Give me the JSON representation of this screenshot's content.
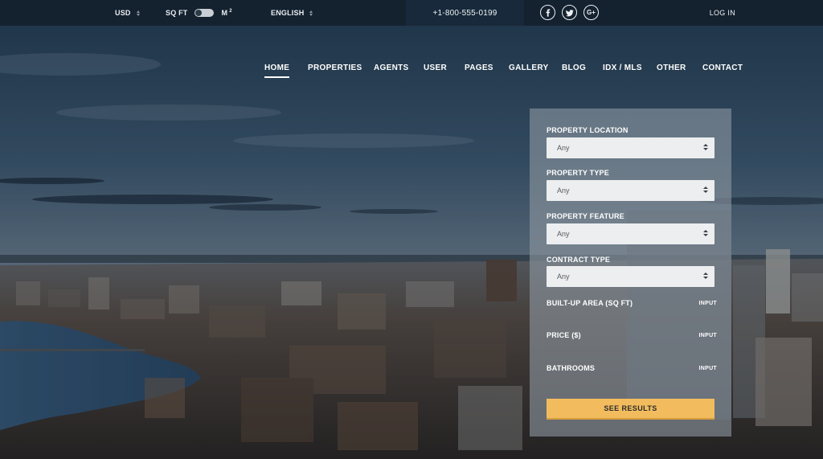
{
  "topbar": {
    "currency": "USD",
    "unit_left": "SQ FT",
    "unit_right": "M",
    "unit_right_sup": "2",
    "language": "ENGLISH",
    "phone": "+1-800-555-0199",
    "social_icons": [
      "facebook-icon",
      "twitter-icon",
      "google-plus-icon"
    ],
    "google_plus_glyph": "G+",
    "login": "LOG IN"
  },
  "nav": {
    "items": [
      "HOME",
      "PROPERTIES",
      "AGENTS",
      "USER",
      "PAGES",
      "GALLERY",
      "BLOG",
      "IDX / MLS",
      "OTHER",
      "CONTACT"
    ],
    "active": "HOME"
  },
  "search": {
    "location_label": "PROPERTY LOCATION",
    "location_value": "Any",
    "type_label": "PROPERTY TYPE",
    "type_value": "Any",
    "feature_label": "PROPERTY FEATURE",
    "feature_value": "Any",
    "contract_label": "CONTRACT TYPE",
    "contract_value": "Any",
    "area_label": "BUILT-UP AREA (SQ FT)",
    "area_input": "INPUT",
    "price_label": "PRICE ($)",
    "price_input": "INPUT",
    "bathrooms_label": "BATHROOMS",
    "bathrooms_input": "INPUT",
    "submit": "SEE RESULTS"
  },
  "colors": {
    "topbar_bg": "#13202d",
    "phone_bg": "#17293a",
    "accent_button": "#f2bc5e",
    "panel_bg": "#8c96a0"
  }
}
